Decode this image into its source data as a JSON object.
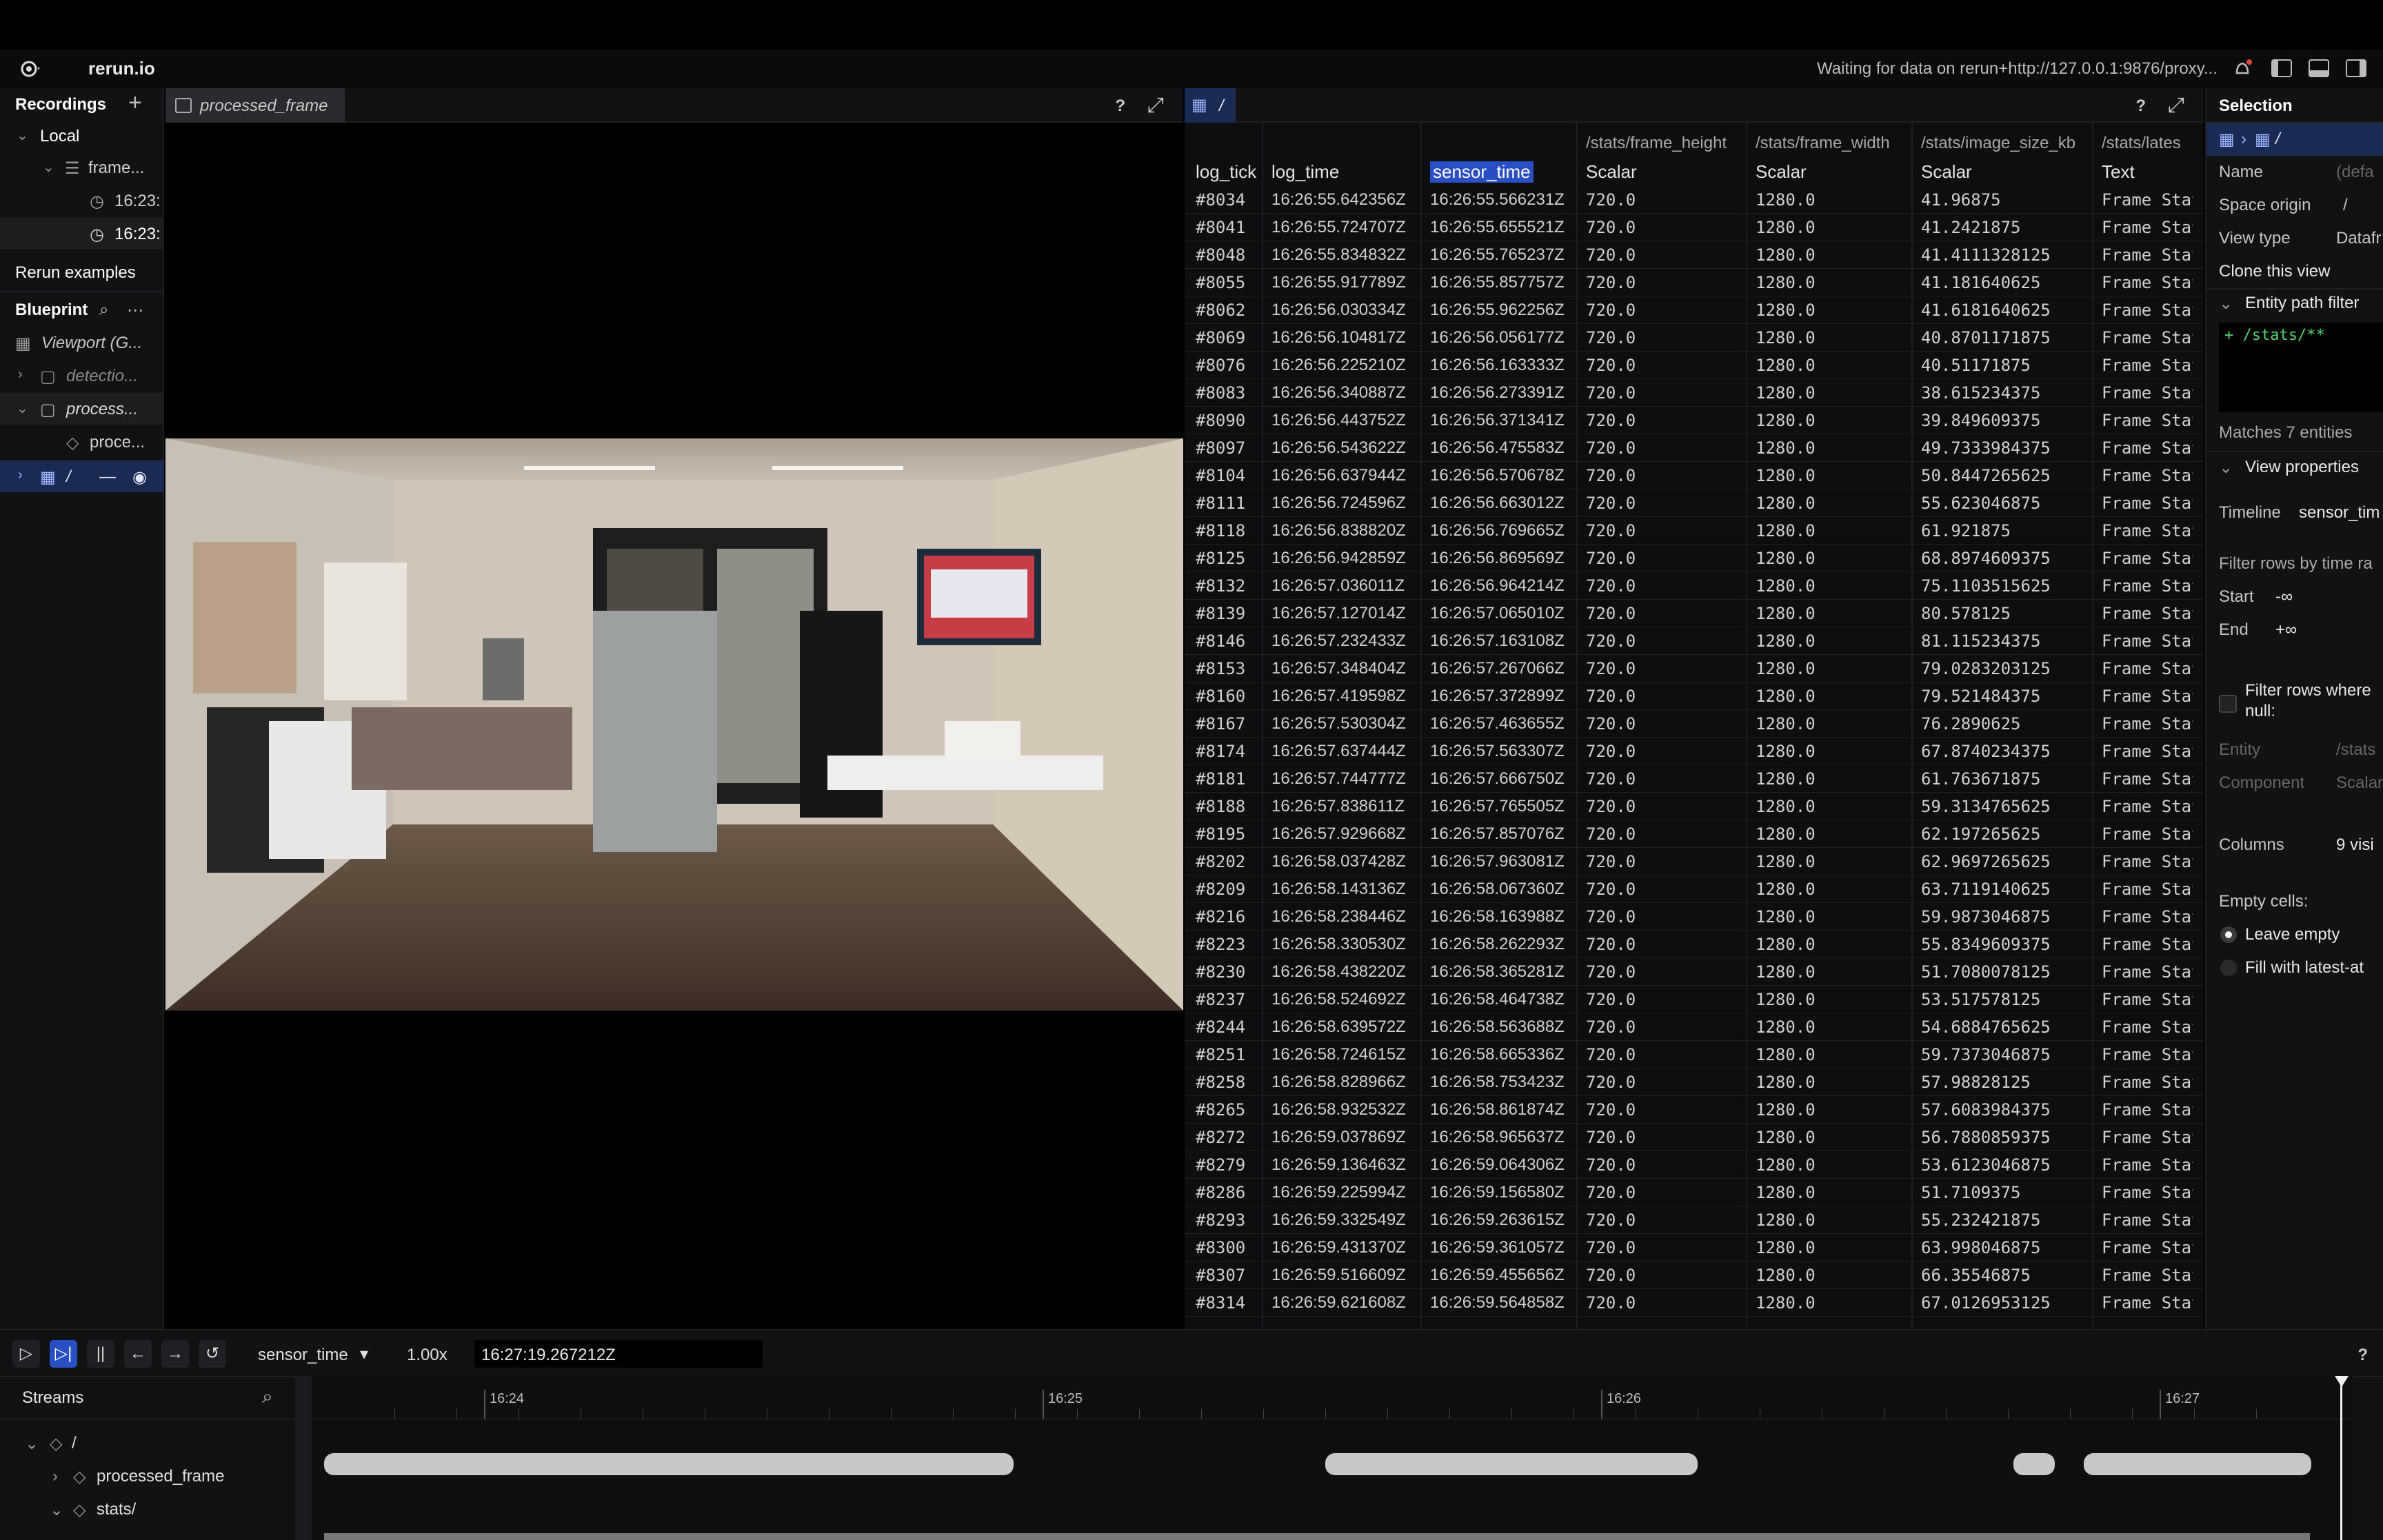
{
  "app": {
    "title": "rerun.io",
    "status": "Waiting for data on rerun+http://127.0.0.1:9876/proxy..."
  },
  "left": {
    "recordings": "Recordings",
    "local": "Local",
    "frame": "frame...",
    "rec_time_1": "16:23:",
    "rec_time_2": "16:23:",
    "examples": "Rerun examples",
    "blueprint": "Blueprint",
    "viewport": "Viewport (G...",
    "detection": "detectio...",
    "processed": "process...",
    "proce_child": "proce...",
    "root": "/"
  },
  "viewer": {
    "tab": "processed_frame",
    "help": "?"
  },
  "table": {
    "tab": "/",
    "help": "?",
    "group_headers": [
      "",
      "",
      "",
      "/stats/frame_height",
      "/stats/frame_width",
      "/stats/image_size_kb",
      "/stats/lates"
    ],
    "columns": [
      "log_tick",
      "log_time",
      "sensor_time",
      "Scalar",
      "Scalar",
      "Scalar",
      "Text"
    ],
    "rows": [
      [
        "#8034",
        "16:26:55.642356Z",
        "16:26:55.566231Z",
        "720.0",
        "1280.0",
        "41.96875",
        "Frame Stat"
      ],
      [
        "#8041",
        "16:26:55.724707Z",
        "16:26:55.655521Z",
        "720.0",
        "1280.0",
        "41.2421875",
        "Frame Stat"
      ],
      [
        "#8048",
        "16:26:55.834832Z",
        "16:26:55.765237Z",
        "720.0",
        "1280.0",
        "41.4111328125",
        "Frame Stat"
      ],
      [
        "#8055",
        "16:26:55.917789Z",
        "16:26:55.857757Z",
        "720.0",
        "1280.0",
        "41.181640625",
        "Frame Stat"
      ],
      [
        "#8062",
        "16:26:56.030334Z",
        "16:26:55.962256Z",
        "720.0",
        "1280.0",
        "41.6181640625",
        "Frame Stat"
      ],
      [
        "#8069",
        "16:26:56.104817Z",
        "16:26:56.056177Z",
        "720.0",
        "1280.0",
        "40.8701171875",
        "Frame Stat"
      ],
      [
        "#8076",
        "16:26:56.225210Z",
        "16:26:56.163333Z",
        "720.0",
        "1280.0",
        "40.51171875",
        "Frame Stat"
      ],
      [
        "#8083",
        "16:26:56.340887Z",
        "16:26:56.273391Z",
        "720.0",
        "1280.0",
        "38.615234375",
        "Frame Stat"
      ],
      [
        "#8090",
        "16:26:56.443752Z",
        "16:26:56.371341Z",
        "720.0",
        "1280.0",
        "39.849609375",
        "Frame Stat"
      ],
      [
        "#8097",
        "16:26:56.543622Z",
        "16:26:56.475583Z",
        "720.0",
        "1280.0",
        "49.7333984375",
        "Frame Stat"
      ],
      [
        "#8104",
        "16:26:56.637944Z",
        "16:26:56.570678Z",
        "720.0",
        "1280.0",
        "50.8447265625",
        "Frame Stat"
      ],
      [
        "#8111",
        "16:26:56.724596Z",
        "16:26:56.663012Z",
        "720.0",
        "1280.0",
        "55.623046875",
        "Frame Stat"
      ],
      [
        "#8118",
        "16:26:56.838820Z",
        "16:26:56.769665Z",
        "720.0",
        "1280.0",
        "61.921875",
        "Frame Stat"
      ],
      [
        "#8125",
        "16:26:56.942859Z",
        "16:26:56.869569Z",
        "720.0",
        "1280.0",
        "68.8974609375",
        "Frame Stat"
      ],
      [
        "#8132",
        "16:26:57.036011Z",
        "16:26:56.964214Z",
        "720.0",
        "1280.0",
        "75.1103515625",
        "Frame Stat"
      ],
      [
        "#8139",
        "16:26:57.127014Z",
        "16:26:57.065010Z",
        "720.0",
        "1280.0",
        "80.578125",
        "Frame Stat"
      ],
      [
        "#8146",
        "16:26:57.232433Z",
        "16:26:57.163108Z",
        "720.0",
        "1280.0",
        "81.115234375",
        "Frame Stat"
      ],
      [
        "#8153",
        "16:26:57.348404Z",
        "16:26:57.267066Z",
        "720.0",
        "1280.0",
        "79.0283203125",
        "Frame Stat"
      ],
      [
        "#8160",
        "16:26:57.419598Z",
        "16:26:57.372899Z",
        "720.0",
        "1280.0",
        "79.521484375",
        "Frame Stat"
      ],
      [
        "#8167",
        "16:26:57.530304Z",
        "16:26:57.463655Z",
        "720.0",
        "1280.0",
        "76.2890625",
        "Frame Stat"
      ],
      [
        "#8174",
        "16:26:57.637444Z",
        "16:26:57.563307Z",
        "720.0",
        "1280.0",
        "67.8740234375",
        "Frame Stat"
      ],
      [
        "#8181",
        "16:26:57.744777Z",
        "16:26:57.666750Z",
        "720.0",
        "1280.0",
        "61.763671875",
        "Frame Stat"
      ],
      [
        "#8188",
        "16:26:57.838611Z",
        "16:26:57.765505Z",
        "720.0",
        "1280.0",
        "59.3134765625",
        "Frame Stat"
      ],
      [
        "#8195",
        "16:26:57.929668Z",
        "16:26:57.857076Z",
        "720.0",
        "1280.0",
        "62.197265625",
        "Frame Stat"
      ],
      [
        "#8202",
        "16:26:58.037428Z",
        "16:26:57.963081Z",
        "720.0",
        "1280.0",
        "62.9697265625",
        "Frame Stat"
      ],
      [
        "#8209",
        "16:26:58.143136Z",
        "16:26:58.067360Z",
        "720.0",
        "1280.0",
        "63.7119140625",
        "Frame Stat"
      ],
      [
        "#8216",
        "16:26:58.238446Z",
        "16:26:58.163988Z",
        "720.0",
        "1280.0",
        "59.9873046875",
        "Frame Stat"
      ],
      [
        "#8223",
        "16:26:58.330530Z",
        "16:26:58.262293Z",
        "720.0",
        "1280.0",
        "55.8349609375",
        "Frame Stat"
      ],
      [
        "#8230",
        "16:26:58.438220Z",
        "16:26:58.365281Z",
        "720.0",
        "1280.0",
        "51.7080078125",
        "Frame Stat"
      ],
      [
        "#8237",
        "16:26:58.524692Z",
        "16:26:58.464738Z",
        "720.0",
        "1280.0",
        "53.517578125",
        "Frame Stat"
      ],
      [
        "#8244",
        "16:26:58.639572Z",
        "16:26:58.563688Z",
        "720.0",
        "1280.0",
        "54.6884765625",
        "Frame Stat"
      ],
      [
        "#8251",
        "16:26:58.724615Z",
        "16:26:58.665336Z",
        "720.0",
        "1280.0",
        "59.7373046875",
        "Frame Stat"
      ],
      [
        "#8258",
        "16:26:58.828966Z",
        "16:26:58.753423Z",
        "720.0",
        "1280.0",
        "57.98828125",
        "Frame Stat"
      ],
      [
        "#8265",
        "16:26:58.932532Z",
        "16:26:58.861874Z",
        "720.0",
        "1280.0",
        "57.6083984375",
        "Frame Stat"
      ],
      [
        "#8272",
        "16:26:59.037869Z",
        "16:26:58.965637Z",
        "720.0",
        "1280.0",
        "56.7880859375",
        "Frame Stat"
      ],
      [
        "#8279",
        "16:26:59.136463Z",
        "16:26:59.064306Z",
        "720.0",
        "1280.0",
        "53.6123046875",
        "Frame Stat"
      ],
      [
        "#8286",
        "16:26:59.225994Z",
        "16:26:59.156580Z",
        "720.0",
        "1280.0",
        "51.7109375",
        "Frame Stat"
      ],
      [
        "#8293",
        "16:26:59.332549Z",
        "16:26:59.263615Z",
        "720.0",
        "1280.0",
        "55.232421875",
        "Frame Stat"
      ],
      [
        "#8300",
        "16:26:59.431370Z",
        "16:26:59.361057Z",
        "720.0",
        "1280.0",
        "63.998046875",
        "Frame Stat"
      ],
      [
        "#8307",
        "16:26:59.516609Z",
        "16:26:59.455656Z",
        "720.0",
        "1280.0",
        "66.35546875",
        "Frame Stat"
      ],
      [
        "#8314",
        "16:26:59.621608Z",
        "16:26:59.564858Z",
        "720.0",
        "1280.0",
        "67.0126953125",
        "Frame Stat"
      ]
    ]
  },
  "selection": {
    "title": "Selection",
    "crumb": "/",
    "name_label": "Name",
    "name_value": "(defa",
    "space_label": "Space origin",
    "space_value": "/",
    "view_label": "View type",
    "view_value": "Datafr",
    "clone": "Clone this view",
    "filter_title": "Entity path filter",
    "filter_value": "+ /stats/**",
    "matches": "Matches 7 entities",
    "view_props": "View properties",
    "timeline_label": "Timeline",
    "timeline_value": "sensor_tim",
    "filter_rows": "Filter rows by time ra",
    "start_label": "Start",
    "start_value": "-∞",
    "end_label": "End",
    "end_value": "+∞",
    "filter_null": "Filter rows where",
    "filter_null2": "null:",
    "entity_label": "Entity",
    "entity_value": "/stats",
    "component_label": "Component",
    "component_value": "Scalar",
    "columns_label": "Columns",
    "columns_value": "9 visi",
    "empty_cells": "Empty cells:",
    "opt_leave": "Leave empty",
    "opt_fill": "Fill with latest-at"
  },
  "timeline": {
    "timeline_name": "sensor_time",
    "speed": "1.00x",
    "current": "16:27:19.267212Z",
    "help": "?",
    "streams": "Streams",
    "ticks": [
      "16:24",
      "16:25",
      "16:26",
      "16:27"
    ],
    "tree_root": "/",
    "tree_processed": "processed_frame",
    "tree_stats": "stats/"
  }
}
